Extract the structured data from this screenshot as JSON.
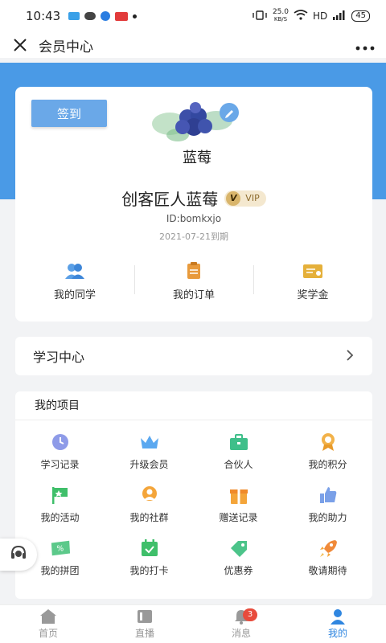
{
  "status_bar": {
    "time": "10:43",
    "network_speed_value": "25.0",
    "network_speed_unit": "KB/S",
    "hd": "HD",
    "battery": "45"
  },
  "header": {
    "title": "会员中心"
  },
  "profile": {
    "checkin_label": "签到",
    "avatar_text": "蓝莓",
    "name": "创客匠人蓝莓",
    "vip_label": "VIP",
    "user_id": "ID:bomkxjo",
    "expiry": "2021-07-21到期",
    "quick_links": [
      {
        "label": "我的同学",
        "icon": "classmates-icon"
      },
      {
        "label": "我的订单",
        "icon": "orders-icon"
      },
      {
        "label": "奖学金",
        "icon": "scholarship-icon"
      }
    ]
  },
  "study_center": {
    "title": "学习中心"
  },
  "projects": {
    "title": "我的项目",
    "items": [
      {
        "label": "学习记录",
        "icon": "clock-icon"
      },
      {
        "label": "升级会员",
        "icon": "crown-icon"
      },
      {
        "label": "合伙人",
        "icon": "briefcase-icon"
      },
      {
        "label": "我的积分",
        "icon": "medal-icon"
      },
      {
        "label": "我的活动",
        "icon": "flag-icon"
      },
      {
        "label": "我的社群",
        "icon": "group-icon"
      },
      {
        "label": "赠送记录",
        "icon": "gift-icon"
      },
      {
        "label": "我的助力",
        "icon": "thumbs-up-icon"
      },
      {
        "label": "我的拼团",
        "icon": "discount-ticket-icon"
      },
      {
        "label": "我的打卡",
        "icon": "calendar-check-icon"
      },
      {
        "label": "优惠券",
        "icon": "tag-icon"
      },
      {
        "label": "敬请期待",
        "icon": "rocket-icon"
      }
    ]
  },
  "tab_bar": {
    "tabs": [
      {
        "label": "首页",
        "icon": "home-icon"
      },
      {
        "label": "直播",
        "icon": "live-icon"
      },
      {
        "label": "消息",
        "icon": "bell-icon",
        "badge": "3"
      },
      {
        "label": "我的",
        "icon": "user-icon"
      }
    ]
  },
  "colors": {
    "primary": "#4a9ae6",
    "active_tab": "#2f86e0",
    "badge": "#e84b3c",
    "vip_gold": "#d9b56b"
  }
}
